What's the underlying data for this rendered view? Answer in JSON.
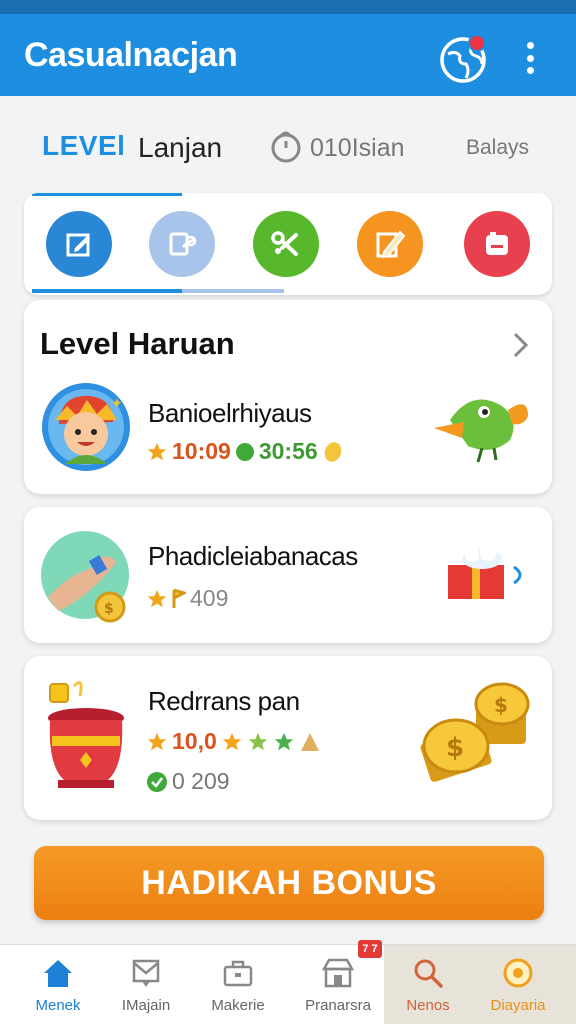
{
  "app": {
    "title": "Casualnacjan",
    "accent": "#1e8fe0",
    "notification_dot_color": "#ee3344"
  },
  "level_header": {
    "level_word": "LEVEl",
    "level_name": "Lanjan",
    "timer_text": "010Isian",
    "days_link": "Balays"
  },
  "category_icons": [
    {
      "name": "edit-square-icon",
      "color": "#2a87d6"
    },
    {
      "name": "edit-note-icon",
      "color": "#a9c4ea"
    },
    {
      "name": "scissors-icon",
      "color": "#58b82c"
    },
    {
      "name": "pencil-icon",
      "color": "#f5941e"
    },
    {
      "name": "camera-icon",
      "color": "#e8404f"
    }
  ],
  "levels_card": {
    "title": "Level Haruan",
    "row": {
      "title": "Banioelrhiyaus",
      "star_value": "10:09",
      "coin_value": "30:56"
    }
  },
  "row2": {
    "title": "Phadicleiabanacas",
    "star_value": "409"
  },
  "row3": {
    "title": "Redrrans pan",
    "star_value": "10,0",
    "coin_value": "0 209"
  },
  "bonus_button": {
    "label": "HADIKAH BONUS",
    "color": "#f08a1a"
  },
  "bottom_nav": {
    "badge": "7 7",
    "items": [
      {
        "label": "Menek",
        "icon": "home-icon",
        "active": true
      },
      {
        "label": "IMajain",
        "icon": "mail-icon"
      },
      {
        "label": "Makerie",
        "icon": "briefcase-icon"
      },
      {
        "label": "Pranarsra",
        "icon": "store-icon"
      },
      {
        "label": "Nenos",
        "icon": "search-icon"
      },
      {
        "label": "Diayaria",
        "icon": "coin-icon"
      }
    ]
  }
}
